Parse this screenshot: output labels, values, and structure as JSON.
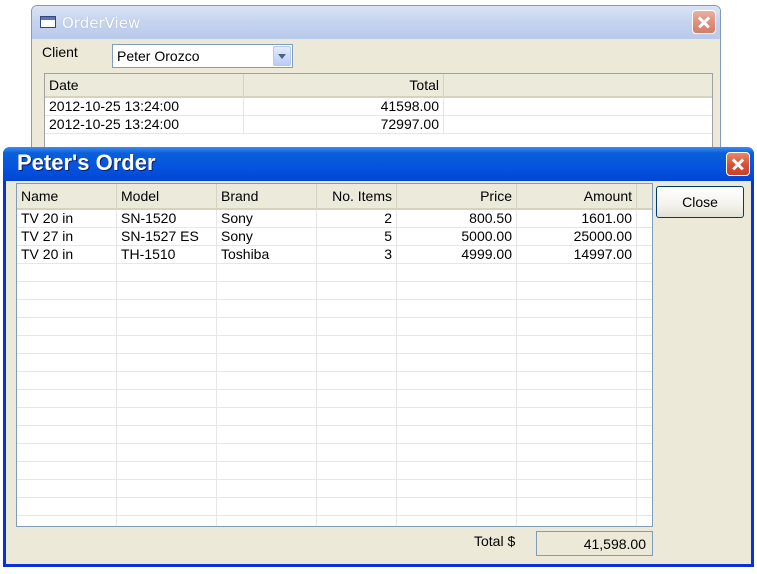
{
  "order_view": {
    "title": "OrderView",
    "client_label": "Client",
    "client_value": "Peter Orozco",
    "columns": [
      "Date",
      "Total"
    ],
    "orders": [
      {
        "date": "2012-10-25 13:24:00",
        "total": "41598.00"
      },
      {
        "date": "2012-10-25 13:24:00",
        "total": "72997.00"
      }
    ]
  },
  "order_detail": {
    "title": "Peter's Order",
    "close_label": "Close",
    "columns": [
      "Name",
      "Model",
      "Brand",
      "No. Items",
      "Price",
      "Amount"
    ],
    "items": [
      {
        "name": "TV 20 in",
        "model": "SN-1520",
        "brand": "Sony",
        "items": "2",
        "price": "800.50",
        "amount": "1601.00"
      },
      {
        "name": "TV 27 in",
        "model": "SN-1527 ES",
        "brand": "Sony",
        "items": "5",
        "price": "5000.00",
        "amount": "25000.00"
      },
      {
        "name": "TV 20 in",
        "model": "TH-1510",
        "brand": "Toshiba",
        "items": "3",
        "price": "4999.00",
        "amount": "14997.00"
      }
    ],
    "total_label": "Total $",
    "total_value": "41,598.00"
  }
}
